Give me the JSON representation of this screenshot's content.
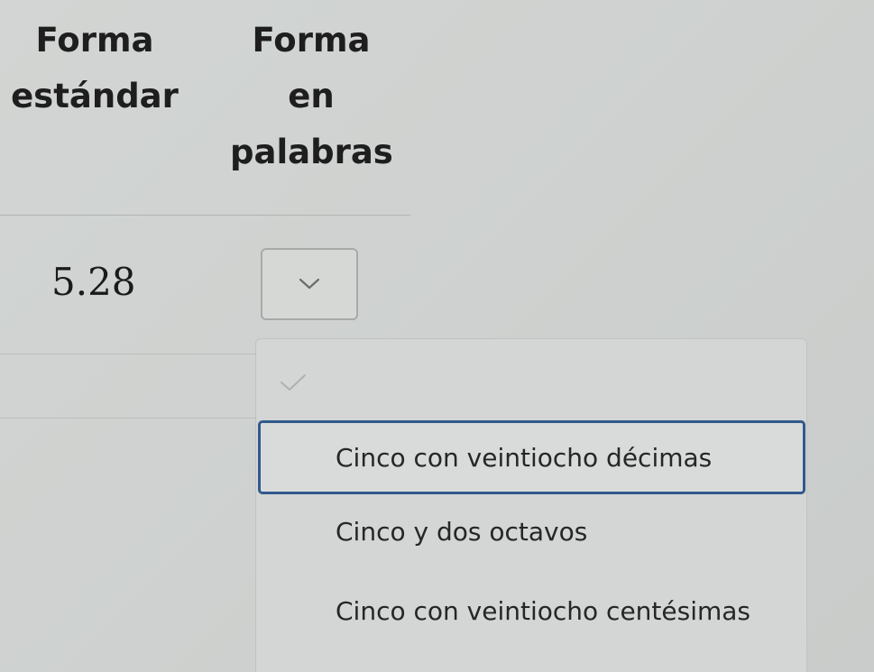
{
  "table": {
    "header_standard": "Forma estándar",
    "header_words": "Forma en palabras",
    "row_value": "5.28"
  },
  "dropdown": {
    "selected": "",
    "options": [
      "Cinco con veintiocho décimas",
      "Cinco y dos octavos",
      "Cinco con veintiocho centésimas"
    ],
    "highlighted_index": 0
  },
  "icons": {
    "select_arrow": "chevron-down-icon",
    "empty_option_mark": "check-icon"
  },
  "colors": {
    "highlight_border": "#31598e",
    "background": "#d0d3d1"
  }
}
